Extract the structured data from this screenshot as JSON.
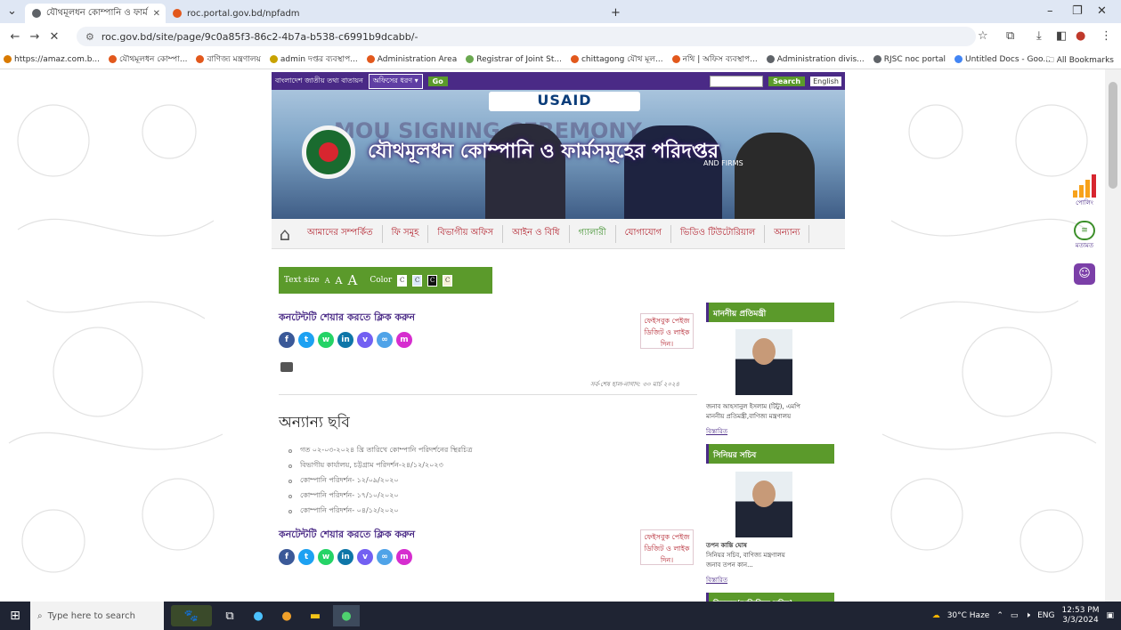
{
  "browser": {
    "tabs": [
      {
        "label": "যৌথমূলধন কোম্পানি ও ফার্ম",
        "color": "#5f6368",
        "active": true
      },
      {
        "label": "roc.portal.gov.bd/npfadmin/pu",
        "color": "#e2581c",
        "active": false
      }
    ],
    "new_tab": "+",
    "url": "roc.gov.bd/site/page/9c0a85f3-86c2-4b7a-b538-c6991b9dcabb/-",
    "bookmarks": [
      {
        "label": "https://amaz.com.b...",
        "color": "#d97a00"
      },
      {
        "label": "যৌথমূলধন কোম্পা...",
        "color": "#e2581c"
      },
      {
        "label": "বাণিজ্য মন্ত্রণালয়",
        "color": "#e2581c"
      },
      {
        "label": "admin দপ্তর ব্যবস্থাপ...",
        "color": "#c8a200"
      },
      {
        "label": "Administration Area",
        "color": "#e2581c"
      },
      {
        "label": "Registrar of Joint St...",
        "color": "#6aa84f"
      },
      {
        "label": "chittagong যৌথ মূল...",
        "color": "#e2581c"
      },
      {
        "label": "নথি | অফিস ব্যবস্থাপ...",
        "color": "#e2581c"
      },
      {
        "label": "Administration divis...",
        "color": "#5f6368"
      },
      {
        "label": "RJSC noc portal",
        "color": "#5f6368"
      },
      {
        "label": "Untitled Docs - Goo...",
        "color": "#4285f4"
      }
    ],
    "all_bookmarks": "All Bookmarks"
  },
  "site": {
    "top": {
      "label": "বাংলাদেশ জাতীয় তথ্য বাতায়ন",
      "select": "অফিসের ধরণ",
      "go": "Go",
      "search": "Search",
      "english": "English"
    },
    "banner": {
      "usaid": "USAID",
      "ceremony": "MOU SIGNING CEREMONY",
      "title": "যৌথমূলধন কোম্পানি ও ফার্মসমূহের পরিদপ্তর",
      "firms": "AND FIRMS"
    },
    "nav": [
      "আমাদের সম্পর্কিত",
      "ফি সমূহ",
      "বিভাগীয় অফিস",
      "আইন ও বিধি",
      "গ্যালারী",
      "যোগাযোগ",
      "ভিডিও টিউটোরিয়াল",
      "অন্যান্য"
    ],
    "textsize": {
      "label": "Text size",
      "a1": "A",
      "a2": "A",
      "a3": "A",
      "color_label": "Color",
      "swatch": "C"
    },
    "share": {
      "heading": "কনটেন্টটি শেয়ার করতে ক্লিক করুন",
      "facebook_box": "ফেইসবুক পেইজ ডিজিট ও লাইক দিন।",
      "icons": [
        {
          "name": "facebook-icon",
          "glyph": "f",
          "color": "#3b5998"
        },
        {
          "name": "twitter-icon",
          "glyph": "t",
          "color": "#1da1f2"
        },
        {
          "name": "whatsapp-icon",
          "glyph": "w",
          "color": "#25d366"
        },
        {
          "name": "linkedin-icon",
          "glyph": "in",
          "color": "#0e76a8"
        },
        {
          "name": "viber-icon",
          "glyph": "v",
          "color": "#7360f2"
        },
        {
          "name": "link-icon",
          "glyph": "∞",
          "color": "#4fa3e8"
        },
        {
          "name": "messenger-icon",
          "glyph": "m",
          "color": "#d62dcf"
        }
      ]
    },
    "last_updated": "সর্ব-শেষ হাল-নাগাদ: ৩০ মার্চ ২০২৪",
    "others": {
      "heading": "অন্যান্য ছবি",
      "items": [
        "গত ০২-০৩-২০২৪ খ্রি তারিখে কোম্পানি পরিদর্শনের স্থিরচিত্র",
        "বিভাগীয় কার্যালয়, চট্টগ্রাম পরিদর্শন-২৪/১২/২০২৩",
        "কোম্পানি পরিদর্শন- ১২/০৯/২০২০",
        "কোম্পানি পরিদর্শন- ১৭/১০/২০২০",
        "কোম্পানি পরিদর্শন- ০৪/১২/২০২০"
      ]
    },
    "sidebar": {
      "minister": {
        "heading": "মাননীয় প্রতিমন্ত্রী",
        "name": "জনাব আহসানুল ইসলাম (টিটু), এমপি",
        "title": "মাননীয় প্রতিমন্ত্রী,বাণিজ্য মন্ত্রণালয়",
        "more": "বিস্তারিত"
      },
      "secretary": {
        "heading": "সিনিয়র সচিব",
        "name": "তপন কান্তি ঘোষ",
        "title": "সিনিয়র সচিব, বাণিজ্য মন্ত্রণালয়",
        "extra": "জনাব তপন কান...",
        "more": "বিস্তারিত"
      },
      "registrar_heading": "নিবন্ধক(অতিরিক্ত সচিব)"
    }
  },
  "float": {
    "polling": "পোলিং",
    "feedback": "মতামত"
  },
  "taskbar": {
    "search": "Type here to search",
    "weather": "30°C Haze",
    "lang": "ENG",
    "time": "12:53 PM",
    "date": "3/3/2024"
  }
}
